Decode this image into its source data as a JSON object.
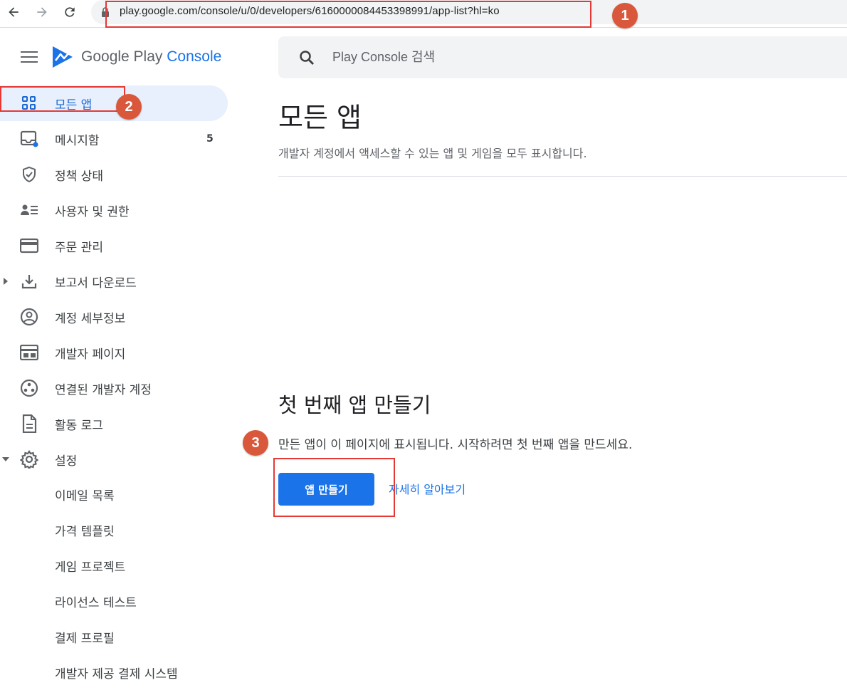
{
  "browser": {
    "url": "play.google.com/console/u/0/developers/6160000084453398991/app-list?hl=ko"
  },
  "annotations": [
    "1",
    "2",
    "3"
  ],
  "logo": {
    "google": "Google Play ",
    "console": "Console"
  },
  "sidebar": {
    "items": [
      {
        "label": "모든 앱"
      },
      {
        "label": "메시지함",
        "count": "5"
      },
      {
        "label": "정책 상태"
      },
      {
        "label": "사용자 및 권한"
      },
      {
        "label": "주문 관리"
      },
      {
        "label": "보고서 다운로드"
      },
      {
        "label": "계정 세부정보"
      },
      {
        "label": "개발자 페이지"
      },
      {
        "label": "연결된 개발자 계정"
      },
      {
        "label": "활동 로그"
      },
      {
        "label": "설정"
      }
    ],
    "settings_sub": [
      "이메일 목록",
      "가격 템플릿",
      "게임 프로젝트",
      "라이선스 테스트",
      "결제 프로필",
      "개발자 제공 결제 시스템"
    ]
  },
  "search": {
    "placeholder": "Play Console 검색"
  },
  "main": {
    "title": "모든 앱",
    "subtitle": "개발자 계정에서 액세스할 수 있는 앱 및 게임을 모두 표시합니다.",
    "empty_title": "첫 번째 앱 만들기",
    "empty_text": "만든 앱이 이 페이지에 표시됩니다. 시작하려면 첫 번째 앱을 만드세요.",
    "create_button": "앱 만들기",
    "learn_more": "자세히 알아보기"
  },
  "colors": {
    "accent": "#1a73e8",
    "active_bg": "#e8f0fe",
    "annotation_badge": "#d9583b",
    "annotation_box": "#e53935"
  }
}
